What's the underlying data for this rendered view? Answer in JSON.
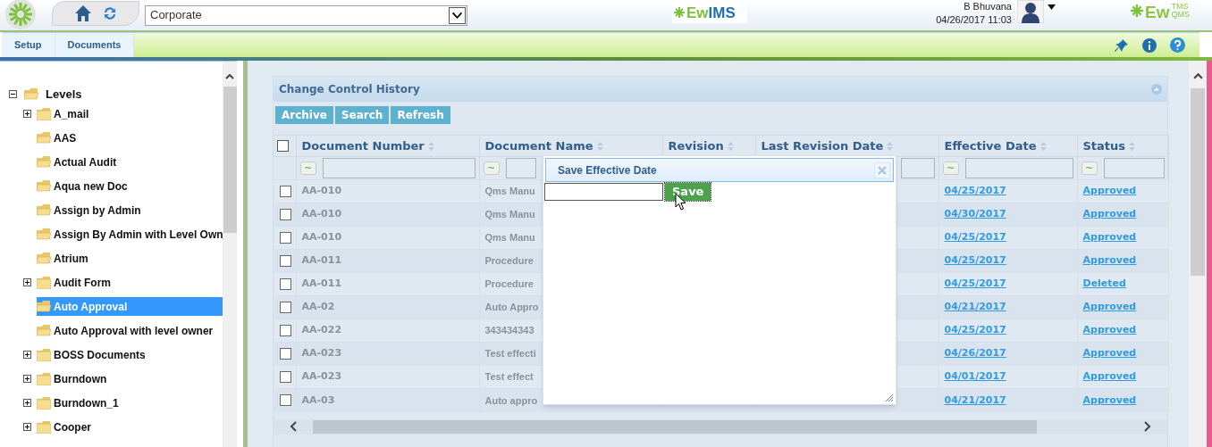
{
  "header": {
    "location_select": {
      "value": "Corporate"
    },
    "center_logo": {
      "part1": "Ew",
      "part2": "IMS"
    },
    "user": {
      "name": "B Bhuvana",
      "datetime": "04/26/2017 11:03"
    },
    "corner_logo": {
      "part1": "Ew",
      "top": "TMS",
      "bottom": "QMS"
    }
  },
  "nav_tabs": [
    {
      "label": "Setup",
      "selected": false
    },
    {
      "label": "Documents",
      "selected": false
    }
  ],
  "tree": {
    "label": "Levels",
    "expanded": true,
    "children": [
      {
        "label": "A_mail",
        "kind": "folder",
        "selected": false
      },
      {
        "label": "AAS",
        "kind": "leaf",
        "selected": false
      },
      {
        "label": "Actual Audit",
        "kind": "leaf",
        "selected": false
      },
      {
        "label": "Aqua new Doc",
        "kind": "leaf",
        "selected": false
      },
      {
        "label": "Assign by Admin",
        "kind": "leaf",
        "selected": false
      },
      {
        "label": "Assign By Admin with Level Own",
        "kind": "leaf",
        "selected": false
      },
      {
        "label": "Atrium",
        "kind": "leaf",
        "selected": false
      },
      {
        "label": "Audit Form",
        "kind": "folder",
        "selected": false
      },
      {
        "label": "Auto Approval",
        "kind": "leaf",
        "selected": true
      },
      {
        "label": "Auto Approval with level owner",
        "kind": "leaf",
        "selected": false
      },
      {
        "label": "BOSS Documents",
        "kind": "folder",
        "selected": false
      },
      {
        "label": "Burndown",
        "kind": "folder",
        "selected": false
      },
      {
        "label": "Burndown_1",
        "kind": "folder",
        "selected": false
      },
      {
        "label": "Cooper",
        "kind": "folder",
        "selected": false
      }
    ]
  },
  "panel": {
    "title": "Change Control History",
    "select_all_checked": false,
    "buttons": [
      "Archive",
      "Search",
      "Refresh"
    ],
    "columns": [
      "Document Number",
      "Document Name",
      "Revision",
      "Last Revision Date",
      "Effective Date",
      "Status"
    ],
    "filter_button": "~",
    "rows": [
      {
        "checked": false,
        "number": "AA-010",
        "name": "Qms Manu",
        "effective": "04/25/2017",
        "status": "Approved"
      },
      {
        "checked": false,
        "number": "AA-010",
        "name": "Qms Manu",
        "effective": "04/30/2017",
        "status": "Approved"
      },
      {
        "checked": false,
        "number": "AA-010",
        "name": "Qms Manu",
        "effective": "04/25/2017",
        "status": "Approved"
      },
      {
        "checked": false,
        "number": "AA-011",
        "name": "Procedure",
        "effective": "04/25/2017",
        "status": "Approved"
      },
      {
        "checked": false,
        "number": "AA-011",
        "name": "Procedure",
        "effective": "04/25/2017",
        "status": "Deleted"
      },
      {
        "checked": false,
        "number": "AA-02",
        "name": "Auto Appro",
        "effective": "04/21/2017",
        "status": "Approved"
      },
      {
        "checked": false,
        "number": "AA-022",
        "name": "343434343",
        "effective": "04/25/2017",
        "status": "Approved"
      },
      {
        "checked": false,
        "number": "AA-023",
        "name": "Test effecti",
        "effective": "04/26/2017",
        "status": "Approved"
      },
      {
        "checked": false,
        "number": "AA-023",
        "name": "Test effect",
        "effective": "04/01/2017",
        "status": "Approved"
      },
      {
        "checked": false,
        "number": "AA-03",
        "name": "Auto appro",
        "effective": "04/21/2017",
        "status": "Approved"
      }
    ]
  },
  "dialog": {
    "title": "Save Effective Date",
    "save_button": "Save"
  }
}
